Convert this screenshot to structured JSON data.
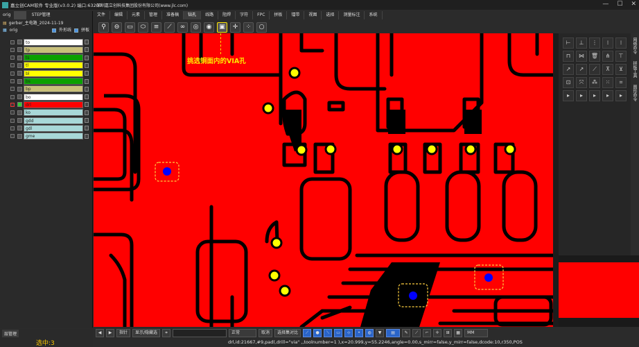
{
  "app": {
    "title": "嘉立创CAM软件 专业版(v3.0.2) 端口:63207",
    "company": "深圳嘉立创科技集团股份有限公司(www.jlc.com)",
    "window_buttons": [
      "—",
      "☐",
      "✕"
    ]
  },
  "menu": {
    "items": [
      "文件",
      "编辑",
      "元素",
      "管理",
      "准备稿",
      "钻孔",
      "线路",
      "阻焊",
      "字符",
      "FPC",
      "拼板",
      "镭带",
      "视图",
      "选择",
      "测量标注",
      "系统"
    ],
    "active": "钻孔"
  },
  "toolbar": {
    "icons": [
      "drill-tool-icon",
      "slot-icon",
      "pad-icon",
      "oval-icon",
      "layers-icon",
      "measure-icon",
      "via-pair-icon",
      "target-icon",
      "target2-icon",
      "via-in-copper-icon",
      "crosshair-icon",
      "grid-icon",
      "search-icon"
    ],
    "selected_index": 9
  },
  "left_panel": {
    "tabs": [
      "orig",
      "STEP管理"
    ],
    "job": "gerber_主电路_2024-11-19",
    "step": "orig",
    "outline_label": "外形线",
    "panel_label": "拼板",
    "layers": [
      {
        "name": "to",
        "color": "#ffffff"
      },
      {
        "name": "tp",
        "color": "#c8c07a"
      },
      {
        "name": "ts",
        "color": "#0aa000"
      },
      {
        "name": "tl",
        "color": "#ffff00"
      },
      {
        "name": "bl",
        "color": "#ffff00"
      },
      {
        "name": "bs",
        "color": "#0aa000"
      },
      {
        "name": "bp",
        "color": "#c8c07a"
      },
      {
        "name": "bo",
        "color": "#ffffff"
      },
      {
        "name": "drl",
        "color": "#ff0000"
      },
      {
        "name": "ko",
        "color": "#a8d8d8"
      },
      {
        "name": "gdd",
        "color": "#a8d8d8"
      },
      {
        "name": "gdl",
        "color": "#a8d8d8"
      },
      {
        "name": "gme",
        "color": "#a8d8d8"
      }
    ],
    "layer_manager": "层管理",
    "selected_count": "选中:3"
  },
  "canvas": {
    "annotation": "挑选铜面内的VIA孔"
  },
  "right_panel": {
    "labels": [
      "网络命令",
      "拼板工具",
      "图形命令"
    ]
  },
  "bottom_bar": {
    "mode": "指针",
    "show_select": "显示/隐藏选",
    "filter": "正常",
    "fit": "取消",
    "select_all": "选择集对比",
    "unit": "MM"
  },
  "status": {
    "text": "drl,id:21667,#9,pad(,drill=\"via\" ,,toolnumber=1 ),x=20.999,y=55.2246,angle=0.00,s_mirr=false,y_mirr=false,dcode:10,r350,POS"
  },
  "colors": {
    "copper": "#ff0000",
    "pad": "#ffff00",
    "selected_via": "#0000ff",
    "highlight": "#ffe600"
  }
}
